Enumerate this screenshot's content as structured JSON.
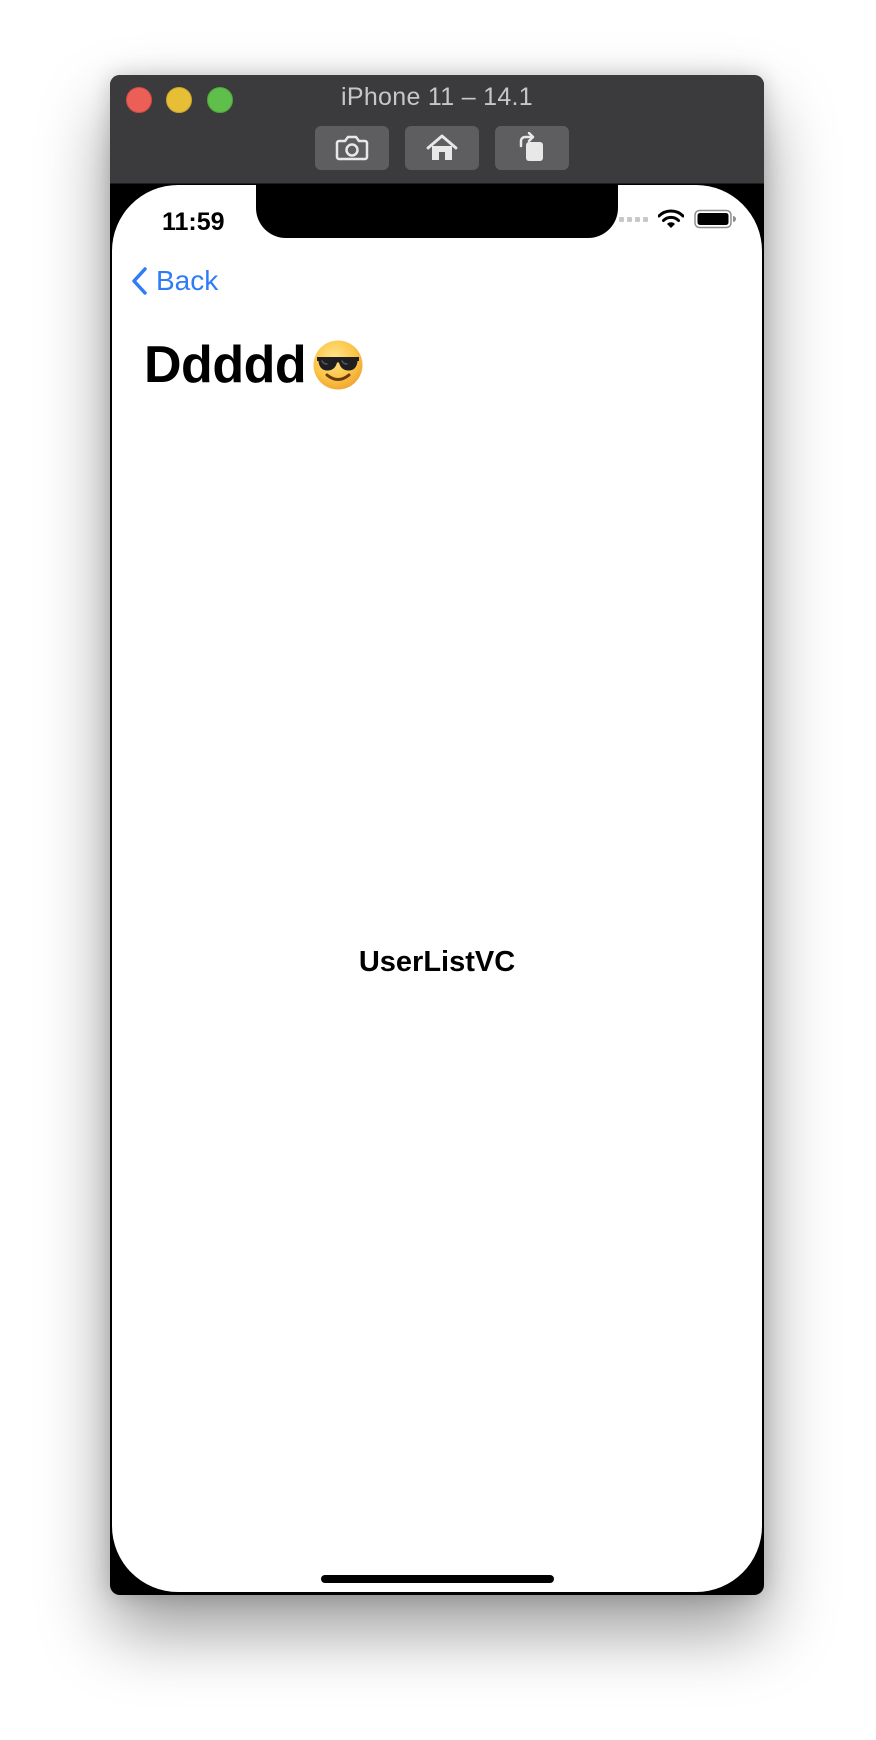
{
  "window": {
    "title": "iPhone 11 – 14.1",
    "toolbar": [
      {
        "icon": "camera-icon",
        "label": "Screenshot"
      },
      {
        "icon": "home-icon",
        "label": "Home"
      },
      {
        "icon": "rotate-icon",
        "label": "Rotate"
      }
    ]
  },
  "status_bar": {
    "time": "11:59",
    "icons": [
      "cellular-signal-icon",
      "wifi-icon",
      "battery-icon"
    ]
  },
  "nav": {
    "back_label": "Back",
    "title": "Ddddd",
    "title_emoji": "smiling-face-with-sunglasses"
  },
  "content": {
    "center_label": "UserListVC"
  },
  "colors": {
    "accent": "#2f7cf6",
    "titlebar": "#3b3b3d",
    "close": "#ec5f57",
    "minimize": "#e6bf37",
    "zoom": "#5fbf4a"
  }
}
